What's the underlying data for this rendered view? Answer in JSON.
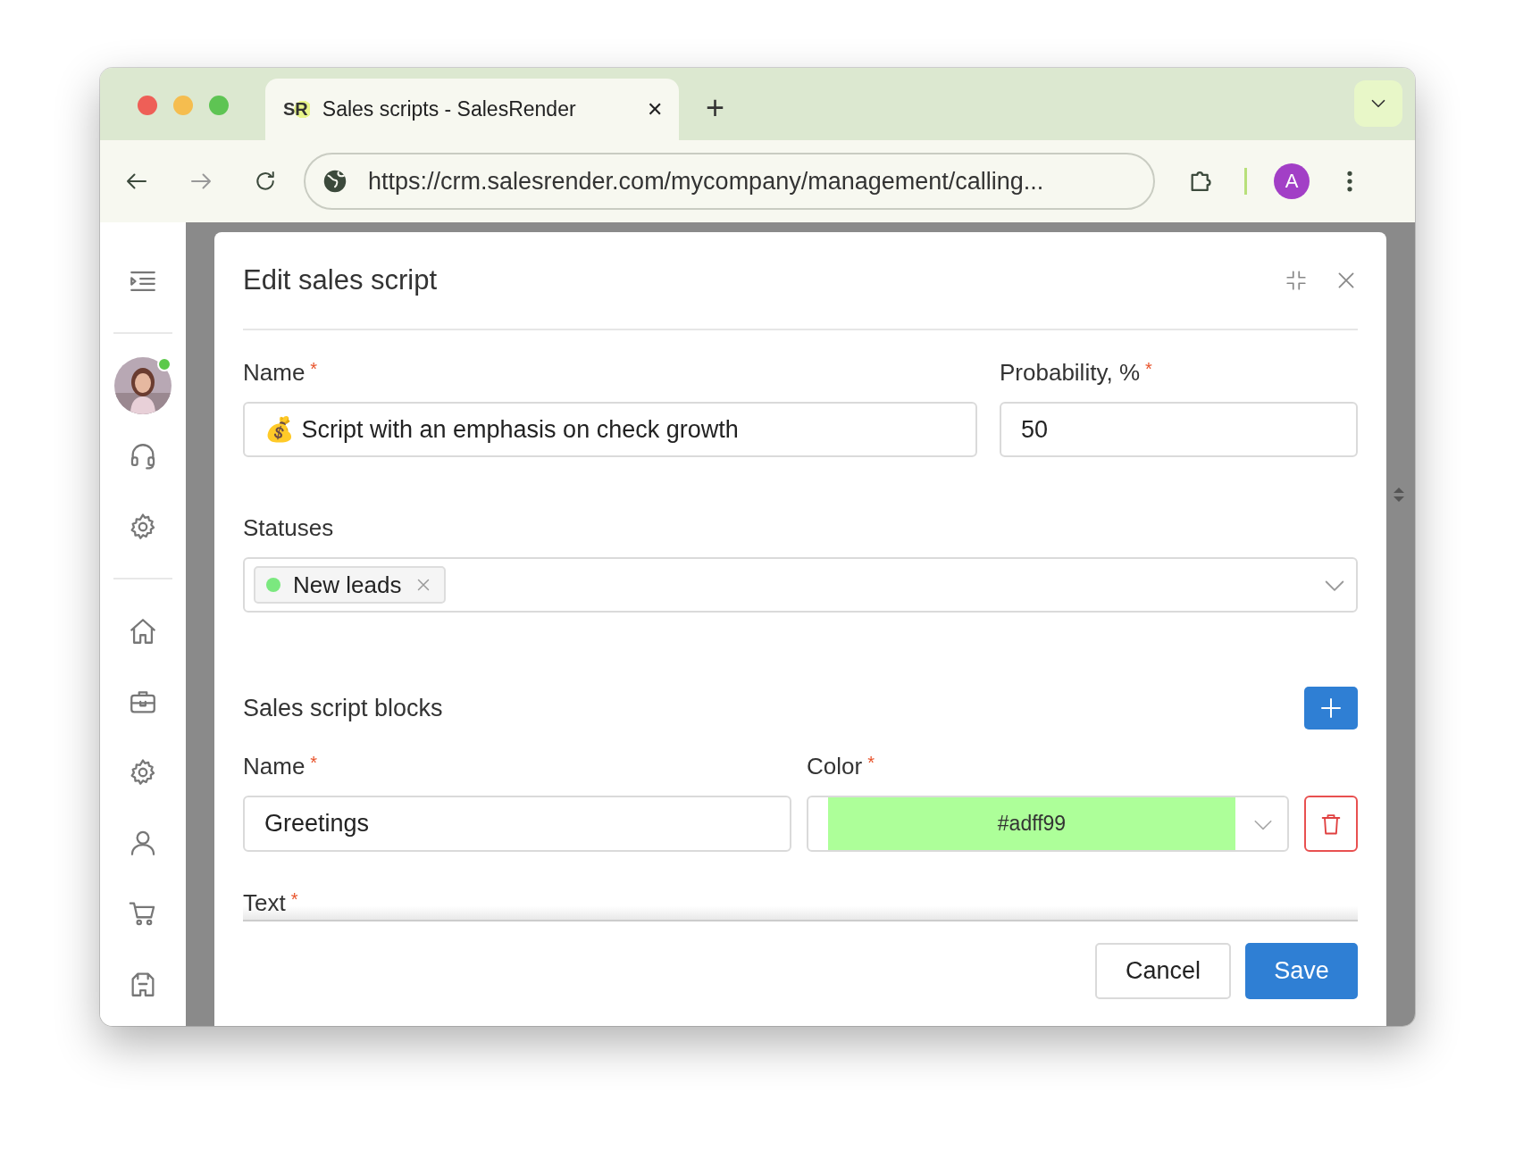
{
  "browser": {
    "tab": {
      "favicon_text": "SR",
      "title": "Sales scripts - SalesRender",
      "close": "✕"
    },
    "new_tab": "+",
    "url": "https://crm.salesrender.com/mycompany/management/calling...",
    "profile_initial": "A"
  },
  "sidebar": {
    "avatar": {
      "kind": "picture",
      "online": true
    }
  },
  "dialog": {
    "title": "Edit sales script",
    "name": {
      "label": "Name",
      "required_mark": "*",
      "value": "💰 Script with an emphasis on check growth"
    },
    "probability": {
      "label": "Probability, %",
      "required_mark": "*",
      "value": "50"
    },
    "statuses": {
      "label": "Statuses",
      "chips": [
        {
          "label": "New leads",
          "color": "#7be87f"
        }
      ]
    },
    "blocks": {
      "title": "Sales script blocks",
      "items": [
        {
          "name_label": "Name",
          "name_required_mark": "*",
          "name": "Greetings",
          "color_label": "Color",
          "color_required_mark": "*",
          "color": "#adff99",
          "text_label": "Text",
          "text_required_mark": "*"
        }
      ]
    },
    "buttons": [
      {
        "label": "Cancel",
        "kind": "secondary"
      },
      {
        "label": "Save",
        "kind": "primary"
      }
    ]
  }
}
